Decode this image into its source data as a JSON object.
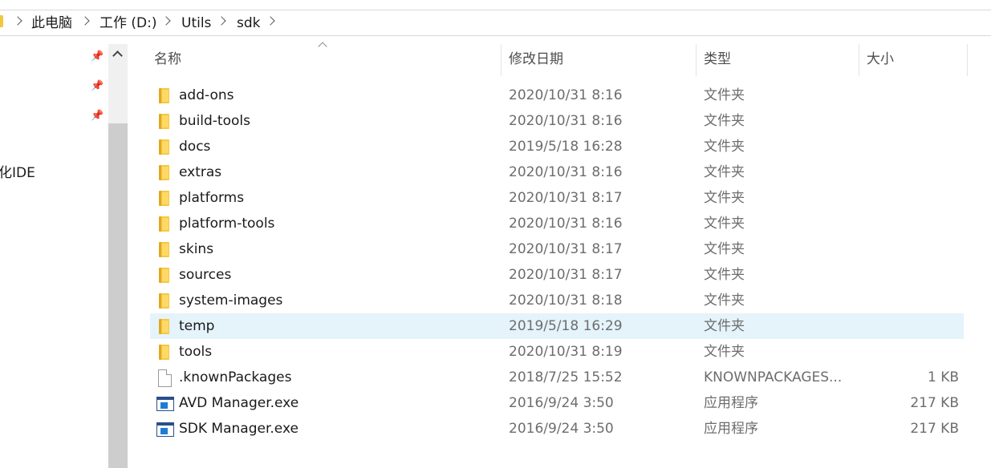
{
  "breadcrumb": [
    "此电脑",
    "工作 (D:)",
    "Utils",
    "sdk"
  ],
  "nav": {
    "partial_item": "化IDE"
  },
  "icons": {
    "pin": "pin-icon",
    "scroll_up": "chevron-up-icon",
    "sort": "sort-ascending-icon"
  },
  "columns": {
    "name": "名称",
    "date": "修改日期",
    "type": "类型",
    "size": "大小"
  },
  "files": [
    {
      "name": "add-ons",
      "date": "2020/10/31 8:16",
      "type": "文件夹",
      "size": "",
      "icon": "folder-icon"
    },
    {
      "name": "build-tools",
      "date": "2020/10/31 8:16",
      "type": "文件夹",
      "size": "",
      "icon": "folder-icon"
    },
    {
      "name": "docs",
      "date": "2019/5/18 16:28",
      "type": "文件夹",
      "size": "",
      "icon": "folder-icon"
    },
    {
      "name": "extras",
      "date": "2020/10/31 8:16",
      "type": "文件夹",
      "size": "",
      "icon": "folder-icon"
    },
    {
      "name": "platforms",
      "date": "2020/10/31 8:17",
      "type": "文件夹",
      "size": "",
      "icon": "folder-icon"
    },
    {
      "name": "platform-tools",
      "date": "2020/10/31 8:16",
      "type": "文件夹",
      "size": "",
      "icon": "folder-icon"
    },
    {
      "name": "skins",
      "date": "2020/10/31 8:17",
      "type": "文件夹",
      "size": "",
      "icon": "folder-icon"
    },
    {
      "name": "sources",
      "date": "2020/10/31 8:17",
      "type": "文件夹",
      "size": "",
      "icon": "folder-icon"
    },
    {
      "name": "system-images",
      "date": "2020/10/31 8:18",
      "type": "文件夹",
      "size": "",
      "icon": "folder-icon"
    },
    {
      "name": "temp",
      "date": "2019/5/18 16:29",
      "type": "文件夹",
      "size": "",
      "icon": "folder-icon",
      "selected": true
    },
    {
      "name": "tools",
      "date": "2020/10/31 8:19",
      "type": "文件夹",
      "size": "",
      "icon": "folder-icon"
    },
    {
      "name": ".knownPackages",
      "date": "2018/7/25 15:52",
      "type": "KNOWNPACKAGES...",
      "size": "1 KB",
      "icon": "file-icon"
    },
    {
      "name": "AVD Manager.exe",
      "date": "2016/9/24 3:50",
      "type": "应用程序",
      "size": "217 KB",
      "icon": "application-icon"
    },
    {
      "name": "SDK Manager.exe",
      "date": "2016/9/24 3:50",
      "type": "应用程序",
      "size": "217 KB",
      "icon": "application-icon"
    }
  ],
  "colors": {
    "selection": "#e5f3fb",
    "folder": "#f5c842",
    "scrollbar_thumb": "#cdcdcd"
  }
}
